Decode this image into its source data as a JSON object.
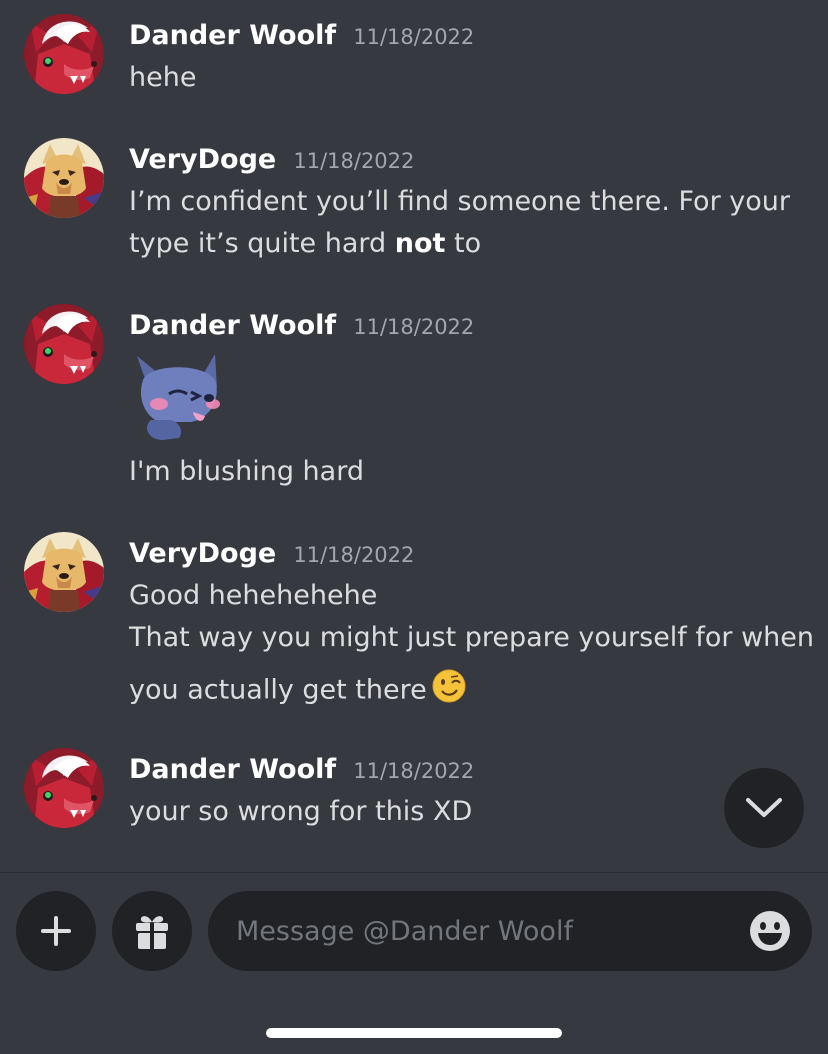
{
  "messages": [
    {
      "author": "Dander Woolf",
      "timestamp": "11/18/2022",
      "avatar": "dander-woolf-avatar",
      "lines": [
        "hehe"
      ]
    },
    {
      "author": "VeryDoge",
      "timestamp": "11/18/2022",
      "avatar": "verydoge-avatar",
      "lines": [
        "I’m confident you’ll find someone there. For your",
        "type it’s quite hard ",
        "not",
        " to"
      ]
    },
    {
      "author": "Dander Woolf",
      "timestamp": "11/18/2022",
      "avatar": "dander-woolf-avatar",
      "sticker": "blushing-wolf-sticker",
      "lines": [
        "I'm blushing hard"
      ]
    },
    {
      "author": "VeryDoge",
      "timestamp": "11/18/2022",
      "avatar": "verydoge-avatar",
      "lines": [
        "Good hehehehehe",
        "That way you might just prepare yourself for when",
        "you actually get there"
      ],
      "emoji": "winking-face-emoji"
    },
    {
      "author": "Dander Woolf",
      "timestamp": "11/18/2022",
      "avatar": "dander-woolf-avatar",
      "lines": [
        "your so wrong for this XD"
      ]
    }
  ],
  "scroll_button": {
    "icon": "chevron-down-icon"
  },
  "composer": {
    "add_icon": "plus-icon",
    "gift_icon": "gift-icon",
    "placeholder": "Message @Dander Woolf",
    "emoji_icon": "smiley-icon"
  },
  "colors": {
    "background": "#36393f",
    "button_bg": "#202225",
    "author": "#ffffff",
    "text": "#dcddde",
    "timestamp": "#a3a6aa"
  }
}
